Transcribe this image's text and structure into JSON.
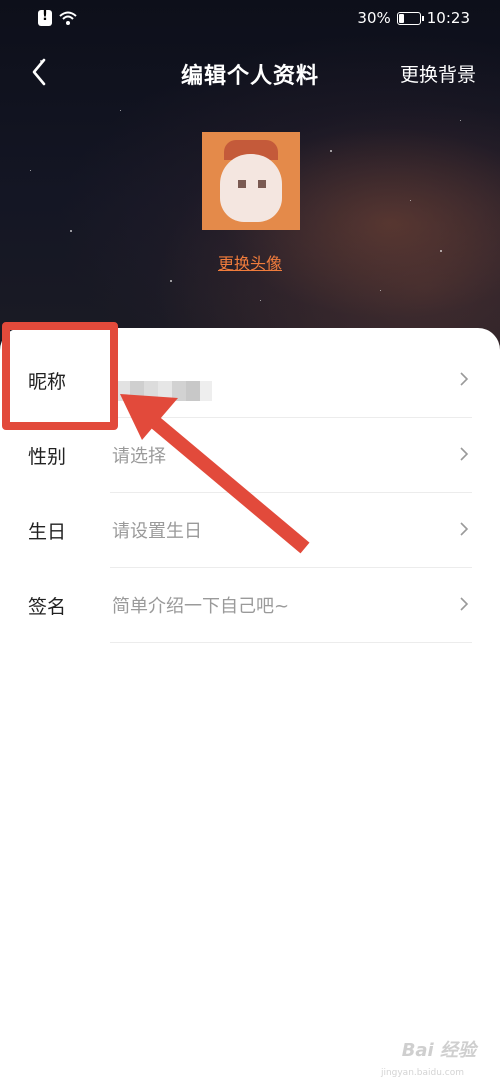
{
  "status_bar": {
    "battery_text": "30%",
    "battery_level": 0.3,
    "time": "10:23",
    "icons": [
      "alert-icon",
      "wifi-icon",
      "battery-icon"
    ]
  },
  "header": {
    "title": "编辑个人资料",
    "change_background_label": "更换背景",
    "back_icon": "chevron-left-icon"
  },
  "profile": {
    "change_avatar_label": "更换头像"
  },
  "form": {
    "rows": [
      {
        "label": "昵称",
        "value": ""
      },
      {
        "label": "性别",
        "value": "请选择"
      },
      {
        "label": "生日",
        "value": "请设置生日"
      },
      {
        "label": "签名",
        "value": "简单介绍一下自己吧~"
      }
    ]
  },
  "annotation": {
    "highlight_color": "#e24a3b"
  },
  "colors": {
    "accent": "#f07c3c"
  },
  "watermark": {
    "text": "Bai 经验",
    "sub": "jingyan.baidu.com"
  }
}
